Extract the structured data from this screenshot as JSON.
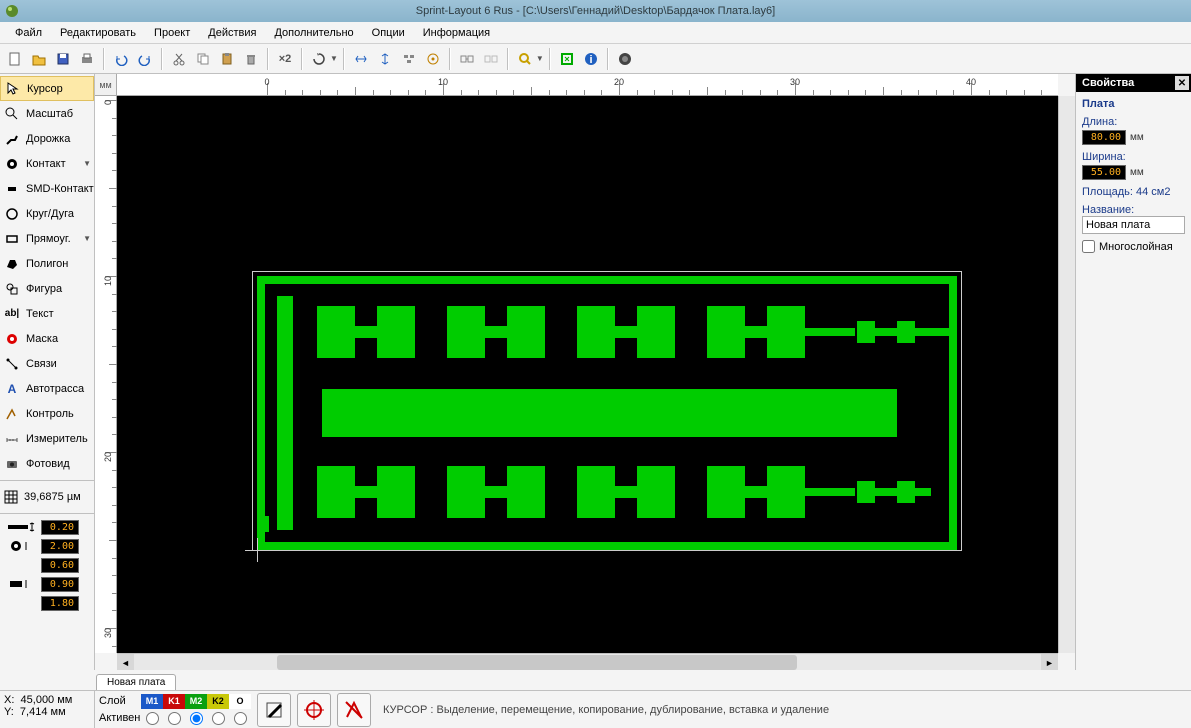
{
  "title": "Sprint-Layout 6 Rus - [C:\\Users\\Геннадий\\Desktop\\Бардачок Плата.lay6]",
  "menus": [
    "Файл",
    "Редактировать",
    "Проект",
    "Действия",
    "Дополнительно",
    "Опции",
    "Информация"
  ],
  "toolbar_x2": "×2",
  "ruler_unit": "мм",
  "tools": [
    {
      "label": "Курсор",
      "icon": "cursor",
      "selected": true,
      "arrow": false
    },
    {
      "label": "Масштаб",
      "icon": "zoom",
      "arrow": false
    },
    {
      "label": "Дорожка",
      "icon": "track",
      "arrow": false
    },
    {
      "label": "Контакт",
      "icon": "pad",
      "arrow": true
    },
    {
      "label": "SMD-Контакт",
      "icon": "smd",
      "arrow": false
    },
    {
      "label": "Круг/Дуга",
      "icon": "circle",
      "arrow": false
    },
    {
      "label": "Прямоуг.",
      "icon": "rect",
      "arrow": true
    },
    {
      "label": "Полигон",
      "icon": "polygon",
      "arrow": false
    },
    {
      "label": "Фигура",
      "icon": "shape",
      "arrow": false
    },
    {
      "label": "Текст",
      "icon": "text",
      "arrow": false
    },
    {
      "label": "Маска",
      "icon": "mask",
      "arrow": false
    },
    {
      "label": "Связи",
      "icon": "conn",
      "arrow": false
    },
    {
      "label": "Автотрасса",
      "icon": "auto",
      "arrow": false
    },
    {
      "label": "Контроль",
      "icon": "check",
      "arrow": false
    },
    {
      "label": "Измеритель",
      "icon": "measure",
      "arrow": false
    },
    {
      "label": "Фотовид",
      "icon": "photo",
      "arrow": false
    }
  ],
  "grid_value": "39,6875 µм",
  "params": [
    {
      "v": "0.20"
    },
    {
      "v": "2.00"
    },
    {
      "v": "0.60"
    },
    {
      "v": "0.90"
    },
    {
      "v": "1.80"
    }
  ],
  "right": {
    "title": "Свойства",
    "section": "Плата",
    "length_lbl": "Длина:",
    "length_val": "80.00",
    "width_lbl": "Ширина:",
    "width_val": "55.00",
    "unit": "мм",
    "area_lbl": "Площадь: 44 см2",
    "name_lbl": "Название:",
    "name_val": "Новая плата",
    "multi_lbl": "Многослойная"
  },
  "tab": "Новая плата",
  "ruler_marks": [
    0,
    10,
    20,
    30,
    40
  ],
  "coords": {
    "x_lbl": "X:",
    "x_val": "45,000 мм",
    "y_lbl": "Y:",
    "y_val": "7,414 мм"
  },
  "layer": {
    "row_lbl": "Слой",
    "active_lbl": "Активен",
    "cells": [
      {
        "t": "M1",
        "c": "#1a58c8"
      },
      {
        "t": "K1",
        "c": "#c80808"
      },
      {
        "t": "M2",
        "c": "#0aa010"
      },
      {
        "t": "K2",
        "c": "#c8c808"
      },
      {
        "t": "O",
        "c": "#f8f8f8",
        "fg": "#000"
      }
    ]
  },
  "status": "КУРСОР  : Выделение, перемещение, копирование, дублирование, вставка и удаление",
  "chart_data": {
    "type": "pcb-layout",
    "board_mm": {
      "w": 80,
      "h": 55
    },
    "view_note": "green copper shapes on black; outline selected"
  }
}
